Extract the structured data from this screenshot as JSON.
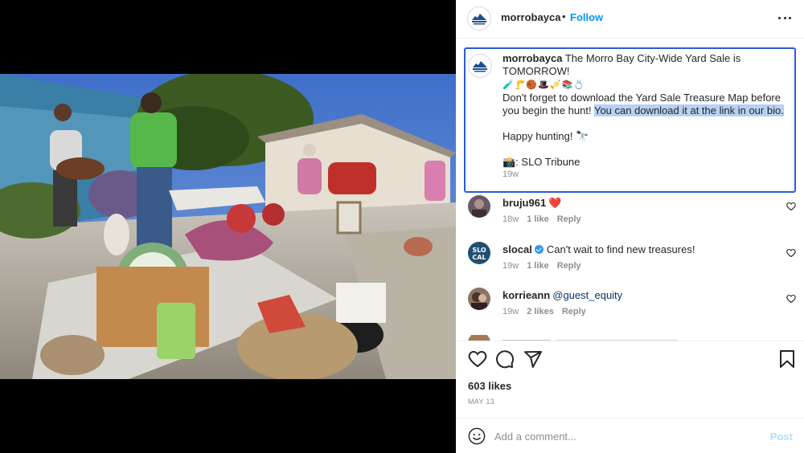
{
  "post": {
    "photo_alt": "Yard sale photo",
    "header": {
      "username": "morrobayca",
      "separator": "•",
      "follow_label": "Follow"
    },
    "caption": {
      "username": "morrobayca",
      "line1": "The Morro Bay City-Wide Yard Sale is TOMORROW!",
      "emojis": "🧪🦵🏀🎩🎺📚💍",
      "line2_before": "Don't forget to download the Yard Sale Treasure Map before you begin the hunt! ",
      "line2_highlight": "You can download it at the link in our bio.",
      "line3": "Happy hunting! 🔭",
      "credit": "📸: SLO Tribune",
      "time": "19w"
    },
    "comments": [
      {
        "username": "bruju961",
        "text": "❤️",
        "time": "18w",
        "likes": "1 like",
        "reply": "Reply"
      },
      {
        "username": "slocal",
        "text": "Can't wait to find new treasures!",
        "time": "19w",
        "likes": "1 like",
        "reply": "Reply"
      },
      {
        "username": "korrieann",
        "text": "@guest_equity",
        "time": "19w",
        "likes": "2 likes",
        "reply": "Reply"
      }
    ],
    "likes_count": "603 likes",
    "date": "MAY 13",
    "add_comment": {
      "placeholder": "Add a comment...",
      "post_label": "Post"
    }
  },
  "colors": {
    "follow": "#0095f6",
    "highlight_border": "#2a5bd7",
    "text_highlight": "#b6d1f2",
    "post_disabled": "#b2dffc"
  },
  "icons": [
    "heart-icon",
    "comment-icon",
    "share-icon",
    "bookmark-icon",
    "emoji-icon",
    "more-options-icon",
    "verified-icon"
  ]
}
